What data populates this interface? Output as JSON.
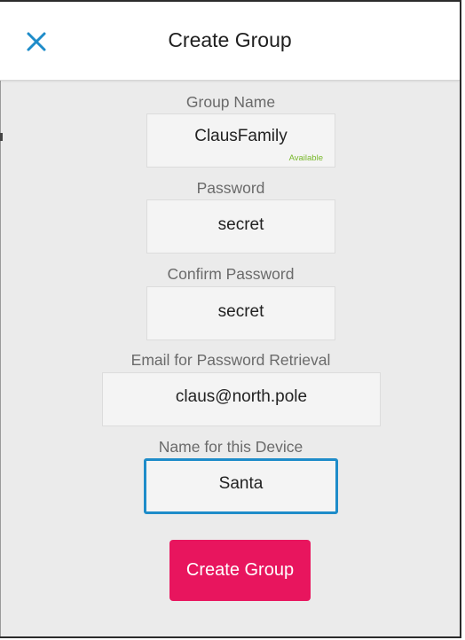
{
  "header": {
    "title": "Create Group",
    "close_icon": "close-icon",
    "accent_color": "#1e8cc9"
  },
  "form": {
    "group_name": {
      "label": "Group Name",
      "value": "ClausFamily",
      "status": "Available",
      "status_color": "#78b82a"
    },
    "password": {
      "label": "Password",
      "value": "secret"
    },
    "confirm_password": {
      "label": "Confirm Password",
      "value": "secret"
    },
    "email": {
      "label": "Email for Password Retrieval",
      "value": "claus@north.pole"
    },
    "device_name": {
      "label": "Name for this Device",
      "value": "Santa"
    },
    "submit_label": "Create Group",
    "submit_color": "#e8155e"
  }
}
